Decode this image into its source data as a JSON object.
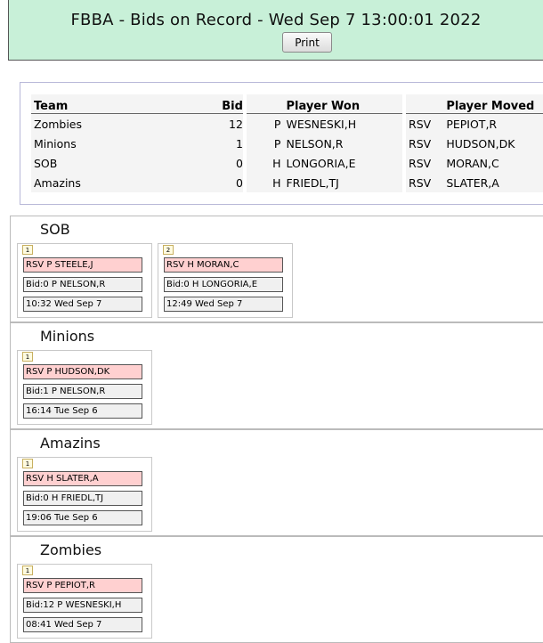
{
  "header": {
    "title": "FBBA - Bids on Record - Wed Sep 7 13:00:01 2022",
    "print_label": "Print"
  },
  "summary": {
    "columns": [
      "Team",
      "Bid",
      "Player Won",
      "Player Moved"
    ],
    "rows": [
      {
        "team": "Zombies",
        "bid": "12",
        "won_pos": "P",
        "won": "WESNESKI,H",
        "rsv": "RSV",
        "moved": "PEPIOT,R"
      },
      {
        "team": "Minions",
        "bid": "1",
        "won_pos": "P",
        "won": "NELSON,R",
        "rsv": "RSV",
        "moved": "HUDSON,DK"
      },
      {
        "team": "SOB",
        "bid": "0",
        "won_pos": "H",
        "won": "LONGORIA,E",
        "rsv": "RSV",
        "moved": "MORAN,C"
      },
      {
        "team": "Amazins",
        "bid": "0",
        "won_pos": "H",
        "won": "FRIEDL,TJ",
        "rsv": "RSV",
        "moved": "SLATER,A"
      }
    ]
  },
  "sections": [
    {
      "team": "SOB",
      "cards": [
        {
          "num": "1",
          "rsv": "RSV P STEELE,J",
          "bid": "Bid:0 P NELSON,R",
          "time": "10:32 Wed Sep 7"
        },
        {
          "num": "2",
          "rsv": "RSV H MORAN,C",
          "bid": "Bid:0 H LONGORIA,E",
          "time": "12:49 Wed Sep 7"
        }
      ]
    },
    {
      "team": "Minions",
      "cards": [
        {
          "num": "1",
          "rsv": "RSV P HUDSON,DK",
          "bid": "Bid:1 P NELSON,R",
          "time": "16:14 Tue Sep 6"
        }
      ]
    },
    {
      "team": "Amazins",
      "cards": [
        {
          "num": "1",
          "rsv": "RSV H SLATER,A",
          "bid": "Bid:0 H FRIEDL,TJ",
          "time": "19:06 Tue Sep 6"
        }
      ]
    },
    {
      "team": "Zombies",
      "cards": [
        {
          "num": "1",
          "rsv": "RSV P PEPIOT,R",
          "bid": "Bid:12 P WESNESKI,H",
          "time": "08:41 Wed Sep 7"
        }
      ]
    }
  ]
}
